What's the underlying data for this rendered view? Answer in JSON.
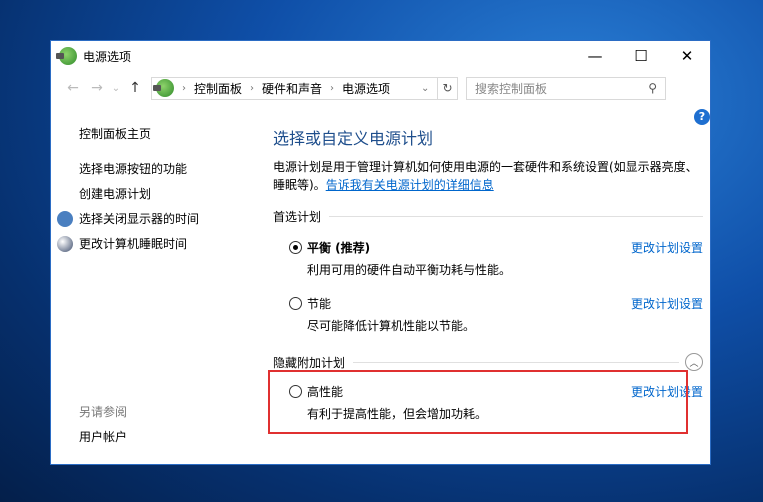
{
  "window": {
    "title": "电源选项",
    "minimize": "—",
    "maximize": "☐",
    "close": "✕"
  },
  "nav": {
    "back": "←",
    "forward": "→",
    "recent": "⌄",
    "up": "↑",
    "breadcrumb": [
      "控制面板",
      "硬件和声音",
      "电源选项"
    ],
    "search_placeholder": "搜索控制面板",
    "refresh": "↻",
    "search_icon": "⚲"
  },
  "sidebar": {
    "home": "控制面板主页",
    "items": [
      "选择电源按钮的功能",
      "创建电源计划",
      "选择关闭显示器的时间",
      "更改计算机睡眠时间"
    ],
    "see_also": "另请参阅",
    "account": "用户帐户"
  },
  "main": {
    "title": "选择或自定义电源计划",
    "desc": "电源计划是用于管理计算机如何使用电源的一套硬件和系统设置(如显示器亮度、睡眠等)。",
    "link": "告诉我有关电源计划的详细信息",
    "preferred_label": "首选计划",
    "hidden_label": "隐藏附加计划",
    "change": "更改计划设置",
    "plans": [
      {
        "name": "平衡 (推荐)",
        "desc": "利用可用的硬件自动平衡功耗与性能。",
        "selected": true
      },
      {
        "name": "节能",
        "desc": "尽可能降低计算机性能以节能。",
        "selected": false
      },
      {
        "name": "高性能",
        "desc": "有利于提高性能，但会增加功耗。",
        "selected": false
      }
    ]
  },
  "help": "?"
}
